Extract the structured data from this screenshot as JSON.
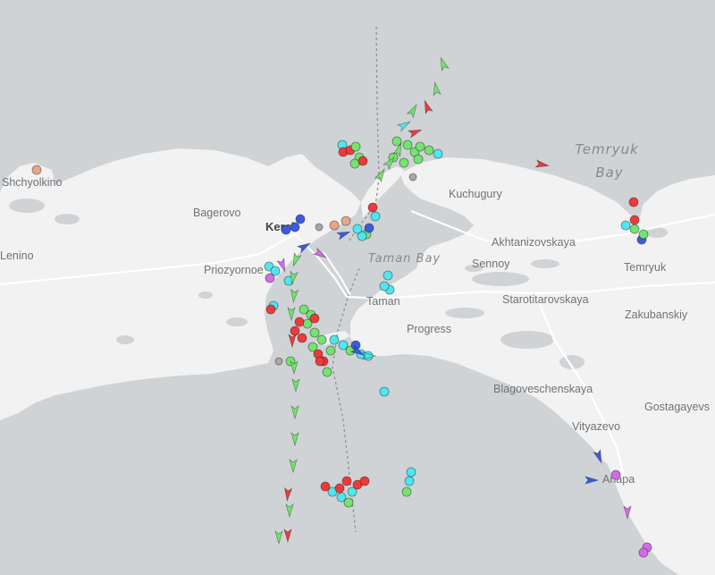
{
  "map": {
    "colors": {
      "water": "#cfd3d6",
      "land": "#f2f2f2",
      "road": "#ffffff",
      "label": "#6f7377",
      "cargo": "#74e36f",
      "tanker": "#ef3a3a",
      "passenger": "#3b5be0",
      "tug": "#4fe6f0",
      "pleasure": "#d46be6",
      "unknown": "#a8a8a8"
    },
    "water_labels": [
      {
        "name": "temryuk-bay-label",
        "lines": [
          "Temryuk",
          "Bay"
        ]
      },
      {
        "name": "taman-bay-label",
        "lines": [
          "Taman Bay"
        ]
      }
    ],
    "places": [
      {
        "name": "shchyolkino",
        "text": "Shchyolkino"
      },
      {
        "name": "bagerovo",
        "text": "Bagerovo"
      },
      {
        "name": "kerch",
        "text": "Kerch"
      },
      {
        "name": "lenino",
        "text": "Lenino"
      },
      {
        "name": "priozyornoe",
        "text": "Priozyornoe"
      },
      {
        "name": "kuchugury",
        "text": "Kuchugury"
      },
      {
        "name": "akhtanizovskaya",
        "text": "Akhtanizovskaya"
      },
      {
        "name": "sennoy",
        "text": "Sennoy"
      },
      {
        "name": "temryuk",
        "text": "Temryuk"
      },
      {
        "name": "taman",
        "text": "Taman"
      },
      {
        "name": "starotitarovskaya",
        "text": "Starotitarovskaya"
      },
      {
        "name": "zakubanskiy",
        "text": "Zakubanskiy"
      },
      {
        "name": "progress",
        "text": "Progress"
      },
      {
        "name": "blagoveschenskaya",
        "text": "Blagoveschenskaya"
      },
      {
        "name": "gostagayevskaya",
        "text": "Gostagayevs"
      },
      {
        "name": "vityazevo",
        "text": "Vityazevo"
      },
      {
        "name": "anapa",
        "text": "Anapa"
      }
    ]
  }
}
